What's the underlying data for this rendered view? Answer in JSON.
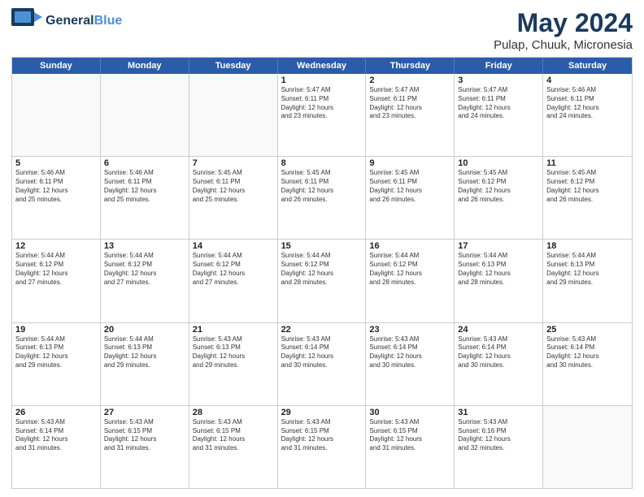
{
  "logo": {
    "line1": "General",
    "line2": "Blue",
    "icon": "▶"
  },
  "title": {
    "month": "May 2024",
    "location": "Pulap, Chuuk, Micronesia"
  },
  "header_days": [
    "Sunday",
    "Monday",
    "Tuesday",
    "Wednesday",
    "Thursday",
    "Friday",
    "Saturday"
  ],
  "weeks": [
    [
      {
        "day": "",
        "info": ""
      },
      {
        "day": "",
        "info": ""
      },
      {
        "day": "",
        "info": ""
      },
      {
        "day": "1",
        "info": "Sunrise: 5:47 AM\nSunset: 6:11 PM\nDaylight: 12 hours\nand 23 minutes."
      },
      {
        "day": "2",
        "info": "Sunrise: 5:47 AM\nSunset: 6:11 PM\nDaylight: 12 hours\nand 23 minutes."
      },
      {
        "day": "3",
        "info": "Sunrise: 5:47 AM\nSunset: 6:11 PM\nDaylight: 12 hours\nand 24 minutes."
      },
      {
        "day": "4",
        "info": "Sunrise: 5:46 AM\nSunset: 6:11 PM\nDaylight: 12 hours\nand 24 minutes."
      }
    ],
    [
      {
        "day": "5",
        "info": "Sunrise: 5:46 AM\nSunset: 6:11 PM\nDaylight: 12 hours\nand 25 minutes."
      },
      {
        "day": "6",
        "info": "Sunrise: 5:46 AM\nSunset: 6:11 PM\nDaylight: 12 hours\nand 25 minutes."
      },
      {
        "day": "7",
        "info": "Sunrise: 5:45 AM\nSunset: 6:11 PM\nDaylight: 12 hours\nand 25 minutes."
      },
      {
        "day": "8",
        "info": "Sunrise: 5:45 AM\nSunset: 6:11 PM\nDaylight: 12 hours\nand 26 minutes."
      },
      {
        "day": "9",
        "info": "Sunrise: 5:45 AM\nSunset: 6:11 PM\nDaylight: 12 hours\nand 26 minutes."
      },
      {
        "day": "10",
        "info": "Sunrise: 5:45 AM\nSunset: 6:12 PM\nDaylight: 12 hours\nand 26 minutes."
      },
      {
        "day": "11",
        "info": "Sunrise: 5:45 AM\nSunset: 6:12 PM\nDaylight: 12 hours\nand 26 minutes."
      }
    ],
    [
      {
        "day": "12",
        "info": "Sunrise: 5:44 AM\nSunset: 6:12 PM\nDaylight: 12 hours\nand 27 minutes."
      },
      {
        "day": "13",
        "info": "Sunrise: 5:44 AM\nSunset: 6:12 PM\nDaylight: 12 hours\nand 27 minutes."
      },
      {
        "day": "14",
        "info": "Sunrise: 5:44 AM\nSunset: 6:12 PM\nDaylight: 12 hours\nand 27 minutes."
      },
      {
        "day": "15",
        "info": "Sunrise: 5:44 AM\nSunset: 6:12 PM\nDaylight: 12 hours\nand 28 minutes."
      },
      {
        "day": "16",
        "info": "Sunrise: 5:44 AM\nSunset: 6:12 PM\nDaylight: 12 hours\nand 28 minutes."
      },
      {
        "day": "17",
        "info": "Sunrise: 5:44 AM\nSunset: 6:13 PM\nDaylight: 12 hours\nand 28 minutes."
      },
      {
        "day": "18",
        "info": "Sunrise: 5:44 AM\nSunset: 6:13 PM\nDaylight: 12 hours\nand 29 minutes."
      }
    ],
    [
      {
        "day": "19",
        "info": "Sunrise: 5:44 AM\nSunset: 6:13 PM\nDaylight: 12 hours\nand 29 minutes."
      },
      {
        "day": "20",
        "info": "Sunrise: 5:44 AM\nSunset: 6:13 PM\nDaylight: 12 hours\nand 29 minutes."
      },
      {
        "day": "21",
        "info": "Sunrise: 5:43 AM\nSunset: 6:13 PM\nDaylight: 12 hours\nand 29 minutes."
      },
      {
        "day": "22",
        "info": "Sunrise: 5:43 AM\nSunset: 6:14 PM\nDaylight: 12 hours\nand 30 minutes."
      },
      {
        "day": "23",
        "info": "Sunrise: 5:43 AM\nSunset: 6:14 PM\nDaylight: 12 hours\nand 30 minutes."
      },
      {
        "day": "24",
        "info": "Sunrise: 5:43 AM\nSunset: 6:14 PM\nDaylight: 12 hours\nand 30 minutes."
      },
      {
        "day": "25",
        "info": "Sunrise: 5:43 AM\nSunset: 6:14 PM\nDaylight: 12 hours\nand 30 minutes."
      }
    ],
    [
      {
        "day": "26",
        "info": "Sunrise: 5:43 AM\nSunset: 6:14 PM\nDaylight: 12 hours\nand 31 minutes."
      },
      {
        "day": "27",
        "info": "Sunrise: 5:43 AM\nSunset: 6:15 PM\nDaylight: 12 hours\nand 31 minutes."
      },
      {
        "day": "28",
        "info": "Sunrise: 5:43 AM\nSunset: 6:15 PM\nDaylight: 12 hours\nand 31 minutes."
      },
      {
        "day": "29",
        "info": "Sunrise: 5:43 AM\nSunset: 6:15 PM\nDaylight: 12 hours\nand 31 minutes."
      },
      {
        "day": "30",
        "info": "Sunrise: 5:43 AM\nSunset: 6:15 PM\nDaylight: 12 hours\nand 31 minutes."
      },
      {
        "day": "31",
        "info": "Sunrise: 5:43 AM\nSunset: 6:16 PM\nDaylight: 12 hours\nand 32 minutes."
      },
      {
        "day": "",
        "info": ""
      }
    ]
  ]
}
